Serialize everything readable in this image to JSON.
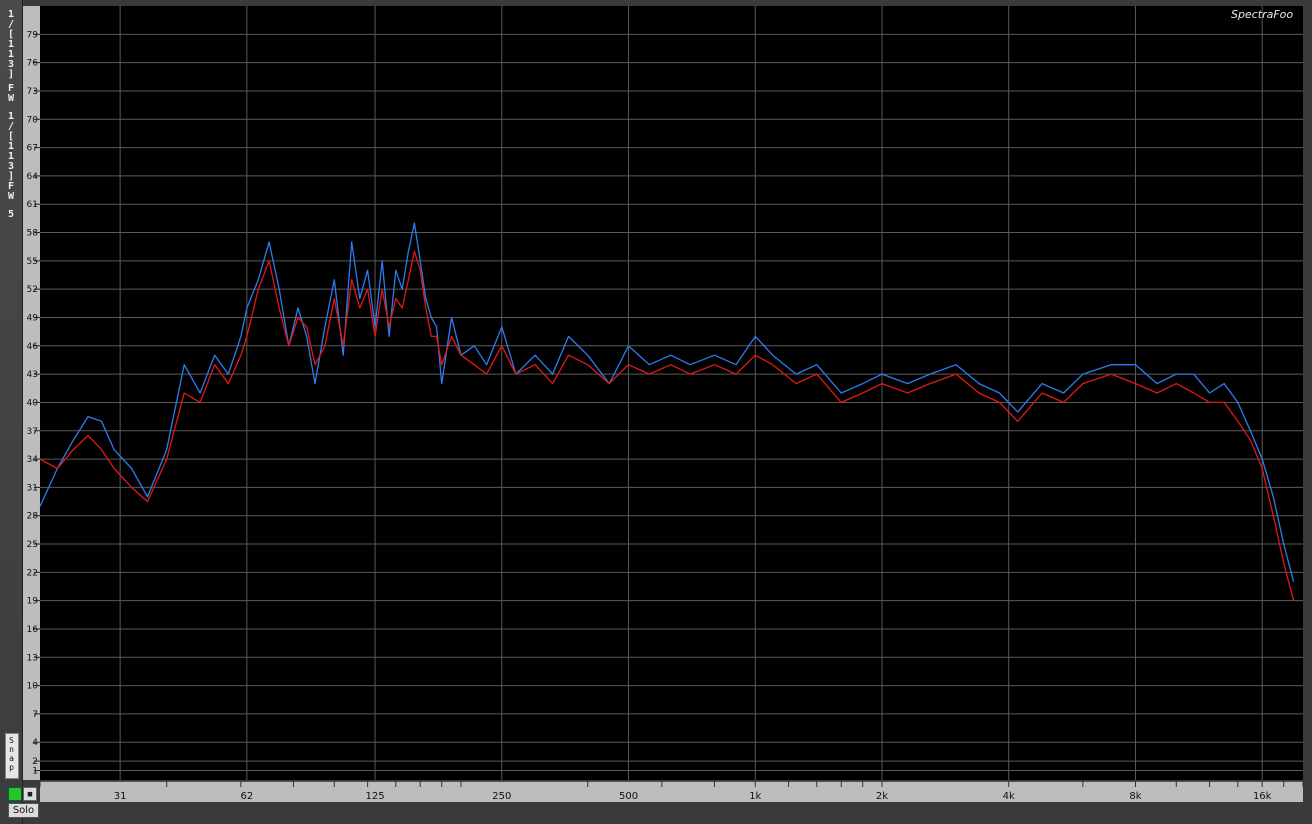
{
  "app": {
    "brand": "SpectraFoo"
  },
  "sidebar": {
    "labels": [
      "1",
      "/",
      "[",
      "1",
      "1",
      "3",
      "]",
      "F",
      "W",
      "1",
      "/",
      "[",
      "1",
      "1",
      "3",
      "]",
      "F",
      "W",
      "5"
    ],
    "snap_label": "Snap",
    "solo_label": "Solo"
  },
  "colors": {
    "left_channel": "#2f7bf0",
    "right_channel": "#e01818",
    "background": "#000000",
    "grid": "#5a5a5a"
  },
  "chart_data": {
    "type": "line",
    "x_scale": "log",
    "x_ticks": [
      "31",
      "62",
      "125",
      "250",
      "500",
      "1k",
      "2k",
      "4k",
      "8k",
      "16k"
    ],
    "y_ticks": [
      "79",
      "76",
      "73",
      "70",
      "67",
      "64",
      "61",
      "58",
      "55",
      "52",
      "49",
      "46",
      "43",
      "40",
      "37",
      "34",
      "31",
      "28",
      "25",
      "22",
      "19",
      "16",
      "13",
      "10",
      "7",
      "4",
      "1",
      "2"
    ],
    "ylim": [
      0,
      82
    ],
    "grid": true,
    "series": [
      {
        "color": "#2f7bf0",
        "x": [
          20,
          22,
          24,
          26,
          28,
          30,
          33,
          36,
          40,
          44,
          48,
          52,
          56,
          60,
          62,
          66,
          70,
          74,
          78,
          82,
          86,
          90,
          95,
          100,
          105,
          110,
          115,
          120,
          125,
          130,
          135,
          140,
          145,
          150,
          155,
          160,
          165,
          170,
          175,
          180,
          190,
          200,
          215,
          230,
          250,
          270,
          300,
          330,
          360,
          400,
          450,
          500,
          560,
          630,
          700,
          800,
          900,
          1000,
          1100,
          1250,
          1400,
          1600,
          1800,
          2000,
          2300,
          2600,
          3000,
          3400,
          3800,
          4200,
          4800,
          5400,
          6000,
          7000,
          8000,
          9000,
          10000,
          11000,
          12000,
          13000,
          14000,
          15000,
          16000,
          17000,
          18000,
          19000
        ],
        "y": [
          29,
          33,
          36,
          38.5,
          38,
          35,
          33,
          30,
          35,
          44,
          41,
          45,
          43,
          47,
          50,
          53,
          57,
          52,
          46,
          50,
          47,
          42,
          48,
          53,
          45,
          57,
          51,
          54,
          48,
          55,
          47,
          54,
          52,
          56,
          59,
          55,
          51,
          49,
          48,
          42,
          49,
          45,
          46,
          44,
          48,
          43,
          45,
          43,
          47,
          45,
          42,
          46,
          44,
          45,
          44,
          45,
          44,
          47,
          45,
          43,
          44,
          41,
          42,
          43,
          42,
          43,
          44,
          42,
          41,
          39,
          42,
          41,
          43,
          44,
          44,
          42,
          43,
          43,
          41,
          42,
          40,
          37,
          34,
          30,
          25,
          21
        ]
      },
      {
        "color": "#e01818",
        "x": [
          20,
          22,
          24,
          26,
          28,
          30,
          33,
          36,
          40,
          44,
          48,
          52,
          56,
          60,
          62,
          66,
          70,
          74,
          78,
          82,
          86,
          90,
          95,
          100,
          105,
          110,
          115,
          120,
          125,
          130,
          135,
          140,
          145,
          150,
          155,
          160,
          165,
          170,
          175,
          180,
          190,
          200,
          215,
          230,
          250,
          270,
          300,
          330,
          360,
          400,
          450,
          500,
          560,
          630,
          700,
          800,
          900,
          1000,
          1100,
          1250,
          1400,
          1600,
          1800,
          2000,
          2300,
          2600,
          3000,
          3400,
          3800,
          4200,
          4800,
          5400,
          6000,
          7000,
          8000,
          9000,
          10000,
          11000,
          12000,
          13000,
          14000,
          15000,
          16000,
          17000,
          18000,
          19000
        ],
        "y": [
          34,
          33,
          35,
          36.5,
          35,
          33,
          31,
          29.5,
          34,
          41,
          40,
          44,
          42,
          45,
          47,
          52,
          55,
          50,
          46,
          49,
          48,
          44,
          46,
          51,
          46,
          53,
          50,
          52,
          47,
          52,
          48,
          51,
          50,
          53,
          56,
          54,
          50,
          47,
          47,
          44,
          47,
          45,
          44,
          43,
          46,
          43,
          44,
          42,
          45,
          44,
          42,
          44,
          43,
          44,
          43,
          44,
          43,
          45,
          44,
          42,
          43,
          40,
          41,
          42,
          41,
          42,
          43,
          41,
          40,
          38,
          41,
          40,
          42,
          43,
          42,
          41,
          42,
          41,
          40,
          40,
          38,
          36,
          33,
          28,
          23,
          19
        ]
      }
    ]
  }
}
